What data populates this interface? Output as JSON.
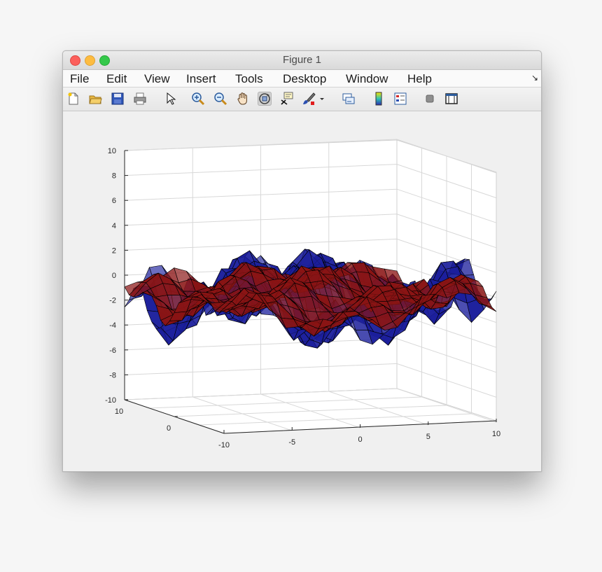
{
  "window": {
    "title": "Figure 1"
  },
  "menu": {
    "items": [
      "File",
      "Edit",
      "View",
      "Insert",
      "Tools",
      "Desktop",
      "Window",
      "Help"
    ],
    "dock_icon": "dock-arrow-icon"
  },
  "toolbar": {
    "buttons": [
      {
        "name": "new-figure-icon"
      },
      {
        "name": "open-file-icon"
      },
      {
        "name": "save-icon"
      },
      {
        "name": "print-icon"
      },
      {
        "name": "edit-plot-pointer-icon"
      },
      {
        "name": "zoom-in-icon"
      },
      {
        "name": "zoom-out-icon"
      },
      {
        "name": "pan-hand-icon"
      },
      {
        "name": "rotate-3d-icon",
        "active": true
      },
      {
        "name": "data-cursor-icon"
      },
      {
        "name": "brush-icon"
      },
      {
        "name": "brush-dropdown-icon"
      },
      {
        "name": "link-plot-icon"
      },
      {
        "name": "insert-colorbar-icon"
      },
      {
        "name": "insert-legend-icon"
      },
      {
        "name": "hide-plot-tools-icon"
      },
      {
        "name": "show-plot-tools-icon"
      }
    ]
  },
  "chart_data": {
    "type": "surface",
    "title": "",
    "xlabel": "",
    "ylabel": "",
    "zlabel": "",
    "xlim": [
      -10,
      10
    ],
    "ylim": [
      -10,
      10
    ],
    "zlim": [
      -10,
      10
    ],
    "xticks": [
      "-10",
      "-5",
      "0",
      "5",
      "10"
    ],
    "yticks": [
      "0",
      "10"
    ],
    "zticks": [
      "10",
      "8",
      "6",
      "4",
      "2",
      "0",
      "-2",
      "-4",
      "-6",
      "-8",
      "-10"
    ],
    "grid": true,
    "series": [
      {
        "color": "#1c1f9c",
        "edgecolor": "#000000",
        "z_range_approx": [
          -5,
          2.5
        ]
      },
      {
        "color": "#8a1414",
        "edgecolor": "#000000",
        "z_range_approx": [
          -3,
          1.5
        ]
      }
    ]
  }
}
